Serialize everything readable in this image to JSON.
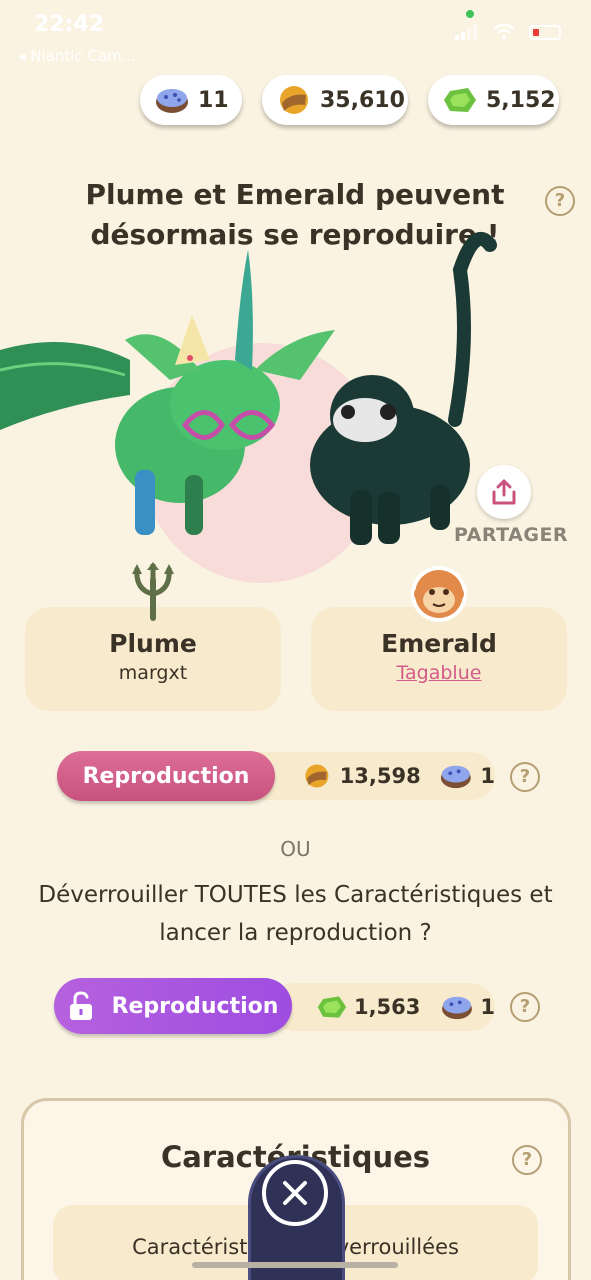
{
  "status": {
    "time": "22:42",
    "back_app": "◂ Niantic Cam..."
  },
  "currencies": [
    {
      "icon": "incubator-egg-icon",
      "value": "11"
    },
    {
      "icon": "coin-icon",
      "value": "35,610"
    },
    {
      "icon": "emerald-gem-icon",
      "value": "5,152"
    }
  ],
  "title": "Plume et Emerald peuvent désormais se reproduire !",
  "share_label": "PARTAGER",
  "parents": [
    {
      "name": "Plume",
      "owner": "margxt",
      "badge": "trident-icon"
    },
    {
      "name": "Emerald",
      "owner": "Tagablue",
      "badge": "monkey-icon"
    }
  ],
  "breed": {
    "label": "Reproduction",
    "coin_cost": "13,598",
    "egg_cost": "1"
  },
  "or_label": "OU",
  "unlock_question": "Déverrouiller TOUTES les Caractéristiques et lancer la reproduction ?",
  "breed_unlock": {
    "label": "Reproduction",
    "gem_cost": "1,563",
    "egg_cost": "1"
  },
  "traits": {
    "title": "Caractéristiques",
    "subtitle": "Caractéristiques déverrouillées"
  },
  "help_glyph": "?",
  "colors": {
    "background": "#fbf3e2",
    "breed_pink": "#d35b8a",
    "breed_purple": "#a755e0",
    "close_tab": "#2f3157"
  }
}
